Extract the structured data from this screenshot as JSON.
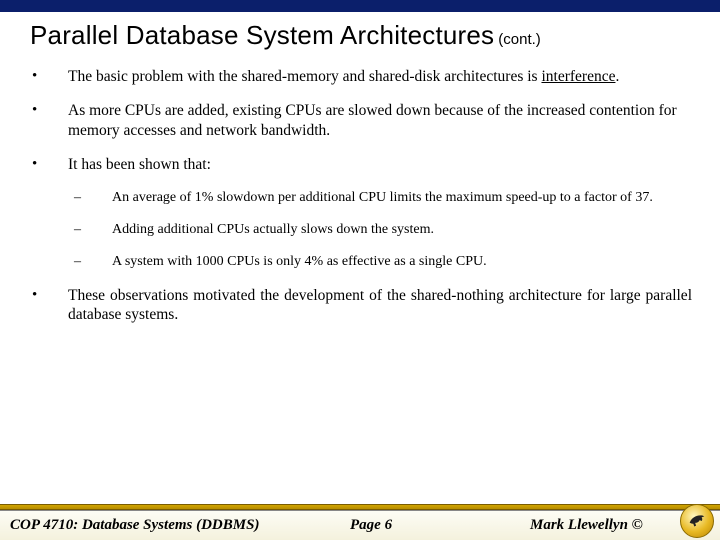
{
  "title": {
    "main": "Parallel Database System Architectures",
    "cont": "(cont.)"
  },
  "bullets": {
    "b1_pre": "The basic problem with the shared-memory and shared-disk architectures is ",
    "b1_underlined": "interference",
    "b1_post": ".",
    "b2": "As more CPUs are added, existing CPUs are slowed down because of the increased contention for memory accesses and network bandwidth.",
    "b3": "It has been shown that:",
    "b4": "These observations motivated the development of the shared-nothing architecture for large parallel database systems."
  },
  "sub": {
    "s1": "An average of 1% slowdown per additional CPU limits the maximum speed-up to a factor of 37.",
    "s2": "Adding additional CPUs actually slows down the system.",
    "s3": "A system with 1000 CPUs is only 4% as effective as a single CPU."
  },
  "footer": {
    "course": "COP 4710: Database Systems  (DDBMS)",
    "page": "Page 6",
    "author": "Mark Llewellyn ©"
  }
}
